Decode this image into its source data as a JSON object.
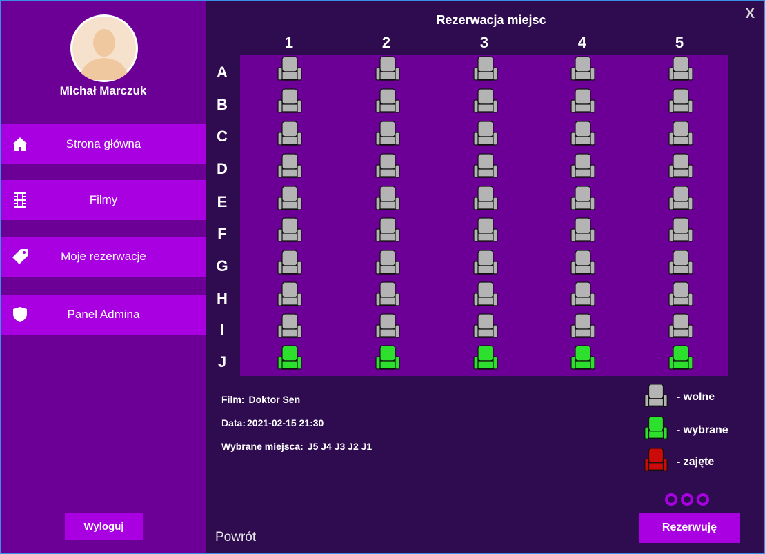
{
  "user": {
    "name": "Michał Marczuk"
  },
  "nav": [
    {
      "label": "Strona główna",
      "icon": "home-icon"
    },
    {
      "label": "Filmy",
      "icon": "film-icon"
    },
    {
      "label": "Moje rezerwacje",
      "icon": "tag-icon"
    },
    {
      "label": "Panel Admina",
      "icon": "shield-icon"
    }
  ],
  "logout_label": "Wyloguj",
  "title": "Rezerwacja miejsc",
  "close_label": "X",
  "columns": [
    "1",
    "2",
    "3",
    "4",
    "5"
  ],
  "rows": [
    "A",
    "B",
    "C",
    "D",
    "E",
    "F",
    "G",
    "H",
    "I",
    "J"
  ],
  "selected_seats": [
    "J1",
    "J2",
    "J3",
    "J4",
    "J5"
  ],
  "info": {
    "film_label": "Film:",
    "film_value": "Doktor Sen",
    "date_label": "Data:",
    "date_value": "2021-02-15 21:30",
    "seats_label": "Wybrane miejsca:",
    "seats_value": "J5 J4 J3 J2 J1"
  },
  "legend": [
    {
      "state": "free",
      "label": "- wolne"
    },
    {
      "state": "selected",
      "label": "- wybrane"
    },
    {
      "state": "taken",
      "label": "- zajęte"
    }
  ],
  "back_label": "Powrót",
  "reserve_label": "Rezerwuję",
  "colors": {
    "sidebar": "#6c0096",
    "accent": "#a800e0",
    "background": "#2f0b4f",
    "seat_free": "#b4b4b4",
    "seat_selected": "#2ee02e",
    "seat_taken": "#cc0a0a"
  }
}
